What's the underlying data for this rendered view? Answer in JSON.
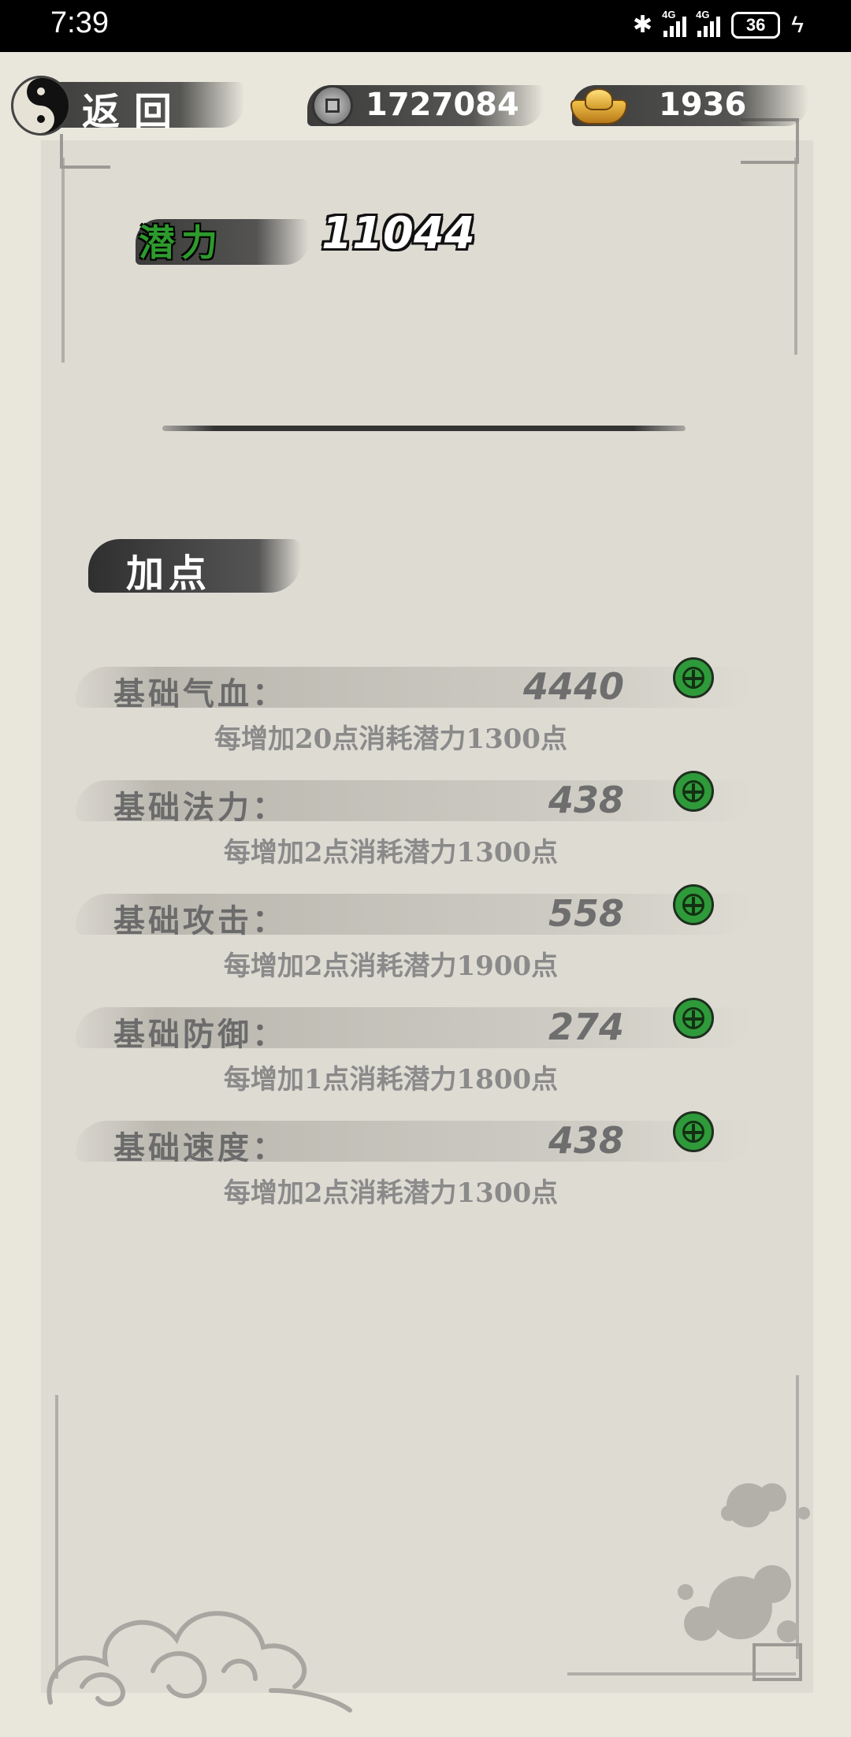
{
  "status_bar": {
    "time": "7:39",
    "network_1": "4G",
    "network_2": "4G",
    "battery": "36"
  },
  "header": {
    "back_label": "返回",
    "copper_coins": "1727084",
    "gold_ingots": "1936",
    "icons": [
      "yinyang-icon",
      "copper-coin-icon",
      "gold-ingot-icon"
    ]
  },
  "potential": {
    "label": "潜力",
    "value": "11044"
  },
  "section": {
    "title": "加点"
  },
  "stats": [
    {
      "label": "基础气血：",
      "value": "4440",
      "desc": "每增加20点消耗潜力1300点"
    },
    {
      "label": "基础法力：",
      "value": "438",
      "desc": "每增加2点消耗潜力1300点"
    },
    {
      "label": "基础攻击：",
      "value": "558",
      "desc": "每增加2点消耗潜力1900点"
    },
    {
      "label": "基础防御：",
      "value": "274",
      "desc": "每增加1点消耗潜力1800点"
    },
    {
      "label": "基础速度：",
      "value": "438",
      "desc": "每增加2点消耗潜力1300点"
    }
  ],
  "colors": {
    "potential_green": "#2d9a2d",
    "plus_button": "#2f9a3a",
    "ink": "#2f2f2f",
    "paper": "#dedbd3"
  }
}
